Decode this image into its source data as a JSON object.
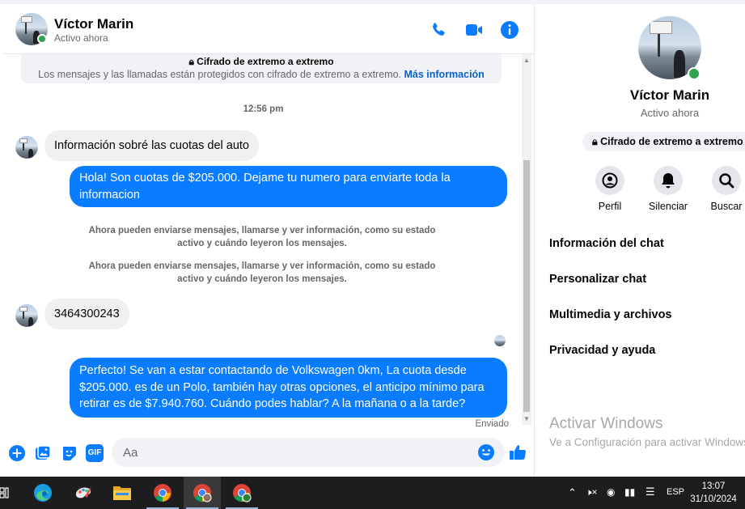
{
  "header": {
    "name": "Víctor Marin",
    "status": "Activo ahora"
  },
  "encryption": {
    "title": "Cifrado de extremo a extremo",
    "text": "Los mensajes y las llamadas están protegidos con cifrado de extremo a extremo.",
    "link": "Más información"
  },
  "messages": {
    "timestamp": "12:56 pm",
    "msg1": "Información sobré las cuotas del auto",
    "msg2_line1": "Hola! Son cuotas de $205.000. Dejame tu numero para enviarte toda la",
    "msg2_line2": "informacion",
    "sys1_line1": "Ahora pueden enviarse mensajes, llamarse y ver información, como su estado",
    "sys1_line2": "activo y cuándo leyeron los mensajes.",
    "sys2_line1": "Ahora pueden enviarse mensajes, llamarse y ver información, como su estado",
    "sys2_line2": "activo y cuándo leyeron los mensajes.",
    "msg3": "3464300243",
    "msg4_line1": "Perfecto!  Se van a estar contactando de Volkswagen 0km, La cuota desde",
    "msg4_line2": "$205.000. es de un Polo, también hay otras opciones, el anticipo mínimo para",
    "msg4_line3": "retirar es de $7.940.760. Cuándo podes hablar? A la mañana o a la tarde?",
    "delivery": "Enviado"
  },
  "composer": {
    "placeholder": "Aa",
    "gif_label": "GIF"
  },
  "info_panel": {
    "name": "Víctor Marin",
    "status": "Activo ahora",
    "encryption": "Cifrado de extremo a extremo",
    "actions": [
      "Perfil",
      "Silenciar",
      "Buscar"
    ],
    "menu": [
      "Información del chat",
      "Personalizar chat",
      "Multimedia y archivos",
      "Privacidad y ayuda"
    ]
  },
  "watermark": {
    "title": "Activar Windows",
    "subtitle": "Ve a Configuración para activar Windows."
  },
  "taskbar": {
    "language": "ESP",
    "time": "13:07",
    "date": "31/10/2024"
  },
  "colors": {
    "accent": "#0a7cff",
    "online": "#31a24c",
    "link": "#0a62c9"
  }
}
